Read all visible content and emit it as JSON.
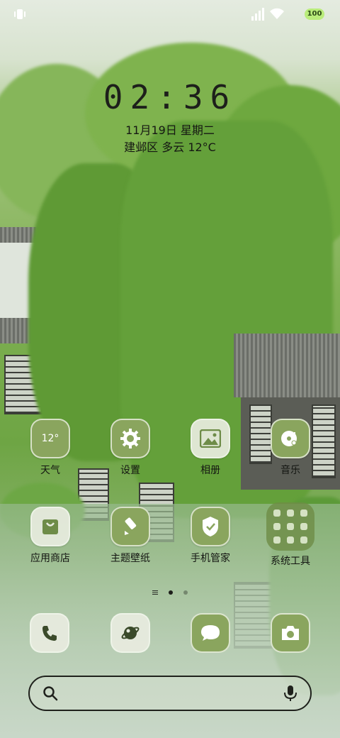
{
  "status_bar": {
    "battery": "100",
    "icons": [
      "vibrate-icon",
      "signal-icon",
      "wifi-icon"
    ]
  },
  "clock": {
    "time": "02:36",
    "date": "11月19日 星期二",
    "weather": "建邺区 多云 12°C"
  },
  "apps": [
    {
      "label": "天气",
      "icon": "weather-icon",
      "text": "12°"
    },
    {
      "label": "设置",
      "icon": "gear-icon"
    },
    {
      "label": "相册",
      "icon": "gallery-icon"
    },
    {
      "label": "音乐",
      "icon": "music-icon"
    },
    {
      "label": "应用商店",
      "icon": "store-bag-icon"
    },
    {
      "label": "主题壁纸",
      "icon": "brush-icon"
    },
    {
      "label": "手机管家",
      "icon": "shield-icon"
    },
    {
      "label": "系统工具",
      "icon": "folder-icon"
    }
  ],
  "pager": {
    "pages": 2,
    "active": 0
  },
  "dock": [
    {
      "icon": "phone-icon"
    },
    {
      "icon": "browser-icon"
    },
    {
      "icon": "message-icon"
    },
    {
      "icon": "camera-icon"
    }
  ],
  "search": {
    "placeholder": ""
  },
  "colors": {
    "accent": "#8aa55e",
    "icon_light": "#e8ece0",
    "text": "#141612"
  }
}
